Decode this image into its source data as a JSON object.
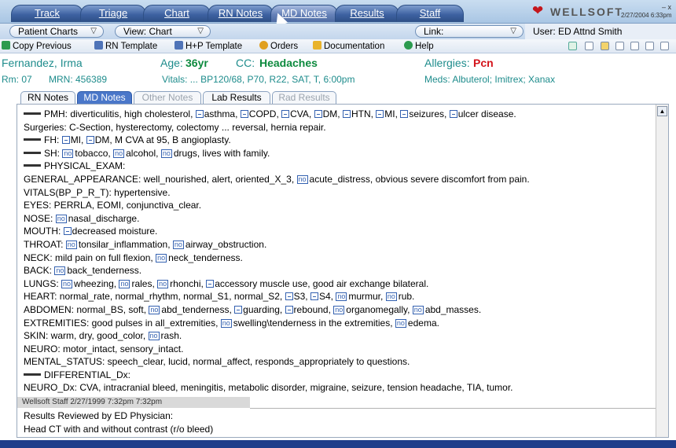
{
  "nav": {
    "tabs": [
      {
        "label": "Track"
      },
      {
        "label": "Triage"
      },
      {
        "label": "Chart"
      },
      {
        "label": "RN Notes"
      },
      {
        "label": "MD Notes"
      },
      {
        "label": "Results"
      },
      {
        "label": "Staff"
      }
    ],
    "brand": "WELLSOFT",
    "datetime": "2/27/2004 6:33pm",
    "window_controls": "– x"
  },
  "row2": {
    "patient_charts": "Patient Charts",
    "view": "View: Chart",
    "link": "Link:",
    "user": "User: ED Attnd Smith"
  },
  "toolbar": {
    "copy_previous": "Copy Previous",
    "rn_template": "RN Template",
    "hp_template": "H+P Template",
    "orders": "Orders",
    "documentation": "Documentation",
    "help": "Help"
  },
  "patient": {
    "name": "Fernandez, Irma",
    "age_label": "Age:",
    "age": "36yr",
    "cc_label": "CC:",
    "cc": "Headaches",
    "allergies_label": "Allergies:",
    "allergies": "Pcn",
    "room": "Rm: 07",
    "mrn": "MRN: 456389",
    "vitals": "Vitals: ... BP120/68, P70, R22, SAT, T, 6:00pm",
    "meds": "Meds: Albuterol; Imitrex; Xanax"
  },
  "subtabs": [
    {
      "label": "RN Notes"
    },
    {
      "label": "MD Notes"
    },
    {
      "label": "Other Notes"
    },
    {
      "label": "Lab Results"
    },
    {
      "label": "Rad Results"
    }
  ],
  "notes": {
    "pmh": "PMH: diverticulitis, high cholesterol,",
    "pmh_items": [
      "asthma,",
      "COPD,",
      "CVA,",
      "DM,",
      "HTN,",
      "MI,",
      "seizures,",
      "ulcer disease."
    ],
    "surgeries": "Surgeries: C-Section, hysterectomy, colectomy ... reversal, hernia repair.",
    "fh": "FH:",
    "fh_mi": "MI,",
    "fh_dm": "DM, M CVA at 95, B angioplasty.",
    "sh": "SH:",
    "sh_tobacco": "tobacco,",
    "sh_alcohol": "alcohol,",
    "sh_drugs": "drugs, lives with family.",
    "physical_exam": "PHYSICAL_EXAM:",
    "general_1": "GENERAL_APPEARANCE: well_nourished, alert, oriented_X_3,",
    "general_2": "acute_distress, obvious severe discomfort from pain.",
    "vitals": "VITALS(BP_P_R_T): hypertensive.",
    "eyes": "EYES: PERRLA, EOMI, conjunctiva_clear.",
    "nose_label": "NOSE:",
    "nose": "nasal_discharge.",
    "mouth_label": "MOUTH:",
    "mouth": "decreased moisture.",
    "throat_label": "THROAT:",
    "throat_1": "tonsilar_inflammation,",
    "throat_2": "airway_obstruction.",
    "neck_1": "NECK: mild pain on full flexion,",
    "neck_2": "neck_tenderness.",
    "back_label": "BACK:",
    "back": "back_tenderness.",
    "lungs_label": "LUNGS:",
    "lungs_1": "wheezing,",
    "lungs_2": "rales,",
    "lungs_3": "rhonchi,",
    "lungs_4": "accessory muscle use, good air exchange bilateral.",
    "heart_1": "HEART: normal_rate, normal_rhythm, normal_S1, normal_S2,",
    "heart_2": "S3,",
    "heart_3": "S4,",
    "heart_4": "murmur,",
    "heart_5": "rub.",
    "abdomen_1": "ABDOMEN: normal_BS, soft,",
    "abdomen_2": "abd_tenderness,",
    "abdomen_3": "guarding,",
    "abdomen_4": "rebound,",
    "abdomen_5": "organomegally,",
    "abdomen_6": "abd_masses.",
    "extremities_1": "EXTREMITIES: good pulses in all_extremities,",
    "extremities_2": "swelling\\tenderness in the extremities,",
    "extremities_3": "edema.",
    "skin_1": "SKIN: warm, dry, good_color,",
    "skin_2": "rash.",
    "neuro": "NEURO: motor_intact, sensory_intact.",
    "mental": "MENTAL_STATUS: speech_clear, lucid, normal_affect, responds_appropriately to questions.",
    "differential": "DIFFERENTIAL_Dx:",
    "neuro_dx": "NEURO_Dx: CVA, intracranial bleed, meningitis, metabolic disorder, migraine, seizure, tension headache, TIA, tumor.",
    "staff_stamp": "Wellsoft Staff       2/27/1999 7:32pm   7:32pm",
    "results_reviewed": "Results Reviewed by ED Physician:",
    "head_ct": "Head CT with and without contrast (r/o bleed)",
    "no_label": "no"
  }
}
